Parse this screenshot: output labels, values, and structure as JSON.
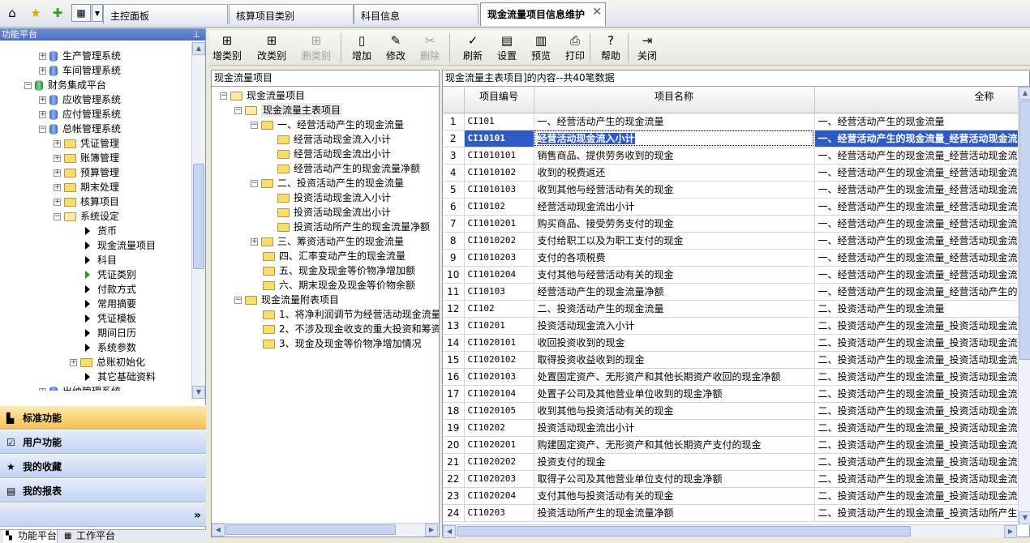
{
  "top_tabs": [
    {
      "label": "主控面板",
      "active": false
    },
    {
      "label": "核算项目类别",
      "active": false
    },
    {
      "label": "科目信息",
      "active": false
    },
    {
      "label": "现金流量项目信息维护",
      "active": true
    }
  ],
  "left_panel": {
    "title": "功能平台",
    "tree": [
      {
        "label": "生产管理系统",
        "level": 0,
        "icon": "db",
        "expander": "+"
      },
      {
        "label": "车间管理系统",
        "level": 0,
        "icon": "db",
        "expander": "+"
      },
      {
        "label": "财务集成平台",
        "level": -1,
        "icon": "db-green",
        "expander": "-"
      },
      {
        "label": "应收管理系统",
        "level": 0,
        "icon": "db",
        "expander": "+"
      },
      {
        "label": "应付管理系统",
        "level": 0,
        "icon": "db",
        "expander": "+"
      },
      {
        "label": "总帐管理系统",
        "level": 0,
        "icon": "db",
        "expander": "-"
      },
      {
        "label": "凭证管理",
        "level": 1,
        "icon": "folder",
        "expander": "+"
      },
      {
        "label": "账簿管理",
        "level": 1,
        "icon": "folder",
        "expander": "+"
      },
      {
        "label": "预算管理",
        "level": 1,
        "icon": "folder",
        "expander": "+"
      },
      {
        "label": "期末处理",
        "level": 1,
        "icon": "folder",
        "expander": "+"
      },
      {
        "label": "核算项目",
        "level": 1,
        "icon": "folder",
        "expander": "+"
      },
      {
        "label": "系统设定",
        "level": 1,
        "icon": "folder-open",
        "expander": "-"
      },
      {
        "label": "货币",
        "level": 2,
        "icon": "arrow",
        "expander": ""
      },
      {
        "label": "现金流量项目",
        "level": 2,
        "icon": "arrow",
        "expander": ""
      },
      {
        "label": "科目",
        "level": 2,
        "icon": "arrow",
        "expander": ""
      },
      {
        "label": "凭证类别",
        "level": 2,
        "icon": "arrow-green",
        "expander": ""
      },
      {
        "label": "付款方式",
        "level": 2,
        "icon": "arrow",
        "expander": ""
      },
      {
        "label": "常用摘要",
        "level": 2,
        "icon": "arrow",
        "expander": ""
      },
      {
        "label": "凭证模板",
        "level": 2,
        "icon": "arrow",
        "expander": ""
      },
      {
        "label": "期间日历",
        "level": 2,
        "icon": "arrow",
        "expander": ""
      },
      {
        "label": "系统参数",
        "level": 2,
        "icon": "arrow",
        "expander": ""
      },
      {
        "label": "总账初始化",
        "level": 2,
        "icon": "folder",
        "expander": "+"
      },
      {
        "label": "其它基础资料",
        "level": 2,
        "icon": "arrow",
        "expander": ""
      },
      {
        "label": "出纳管理系统",
        "level": 0,
        "icon": "db",
        "expander": "+"
      }
    ],
    "sections": [
      {
        "label": "标准功能",
        "selected": true,
        "icon": "standard-icon"
      },
      {
        "label": "用户功能",
        "selected": false,
        "icon": "user-icon"
      },
      {
        "label": "我的收藏",
        "selected": false,
        "icon": "star-icon"
      },
      {
        "label": "我的报表",
        "selected": false,
        "icon": "report-icon"
      }
    ],
    "more_glyph": "»",
    "bottom_tabs": [
      {
        "label": "功能平台",
        "active": true
      },
      {
        "label": "工作平台",
        "active": false
      }
    ]
  },
  "toolbar": [
    {
      "label": "增类别",
      "icon": "add-category-icon",
      "glyph": "⊞",
      "disabled": false
    },
    {
      "label": "改类别",
      "icon": "edit-category-icon",
      "glyph": "⊞",
      "disabled": false
    },
    {
      "label": "删类别",
      "icon": "delete-category-icon",
      "glyph": "⊞",
      "disabled": true
    },
    {
      "label": "增加",
      "icon": "add-icon",
      "glyph": "▯",
      "disabled": false
    },
    {
      "label": "修改",
      "icon": "edit-icon",
      "glyph": "✎",
      "disabled": false
    },
    {
      "label": "删除",
      "icon": "delete-icon",
      "glyph": "✂",
      "disabled": true
    },
    {
      "label": "刷新",
      "icon": "refresh-icon",
      "glyph": "✓",
      "disabled": false
    },
    {
      "label": "设置",
      "icon": "settings-icon",
      "glyph": "▤",
      "disabled": false
    },
    {
      "label": "预览",
      "icon": "preview-icon",
      "glyph": "▥",
      "disabled": false
    },
    {
      "label": "打印",
      "icon": "print-icon",
      "glyph": "⎙",
      "disabled": false
    },
    {
      "label": "帮助",
      "icon": "help-icon",
      "glyph": "?",
      "disabled": false
    },
    {
      "label": "关闭",
      "icon": "close-icon",
      "glyph": "⇥",
      "disabled": false
    }
  ],
  "category_panel": {
    "title": "现金流量项目",
    "tree": [
      {
        "label": "现金流量项目",
        "level": 0,
        "expander": "-",
        "open": true
      },
      {
        "label": "现金流量主表项目",
        "level": 1,
        "expander": "-",
        "open": true,
        "selected": true
      },
      {
        "label": "一、经营活动产生的现金流量",
        "level": 2,
        "expander": "-"
      },
      {
        "label": "经营活动现金流入小计",
        "level": 3,
        "expander": ""
      },
      {
        "label": "经营活动现金流出小计",
        "level": 3,
        "expander": ""
      },
      {
        "label": "经营活动产生的现金流量净额",
        "level": 3,
        "expander": ""
      },
      {
        "label": "二、投资活动产生的现金流量",
        "level": 2,
        "expander": "-"
      },
      {
        "label": "投资活动现金流入小计",
        "level": 3,
        "expander": ""
      },
      {
        "label": "投资活动现金流出小计",
        "level": 3,
        "expander": ""
      },
      {
        "label": "投资活动所产生的现金流量净额",
        "level": 3,
        "expander": ""
      },
      {
        "label": "三、筹资活动产生的现金流量",
        "level": 2,
        "expander": "+"
      },
      {
        "label": "四、汇率变动产生的现金流量",
        "level": 2,
        "expander": ""
      },
      {
        "label": "五、现金及现金等价物净增加额",
        "level": 2,
        "expander": ""
      },
      {
        "label": "六、期末现金及现金等价物余额",
        "level": 2,
        "expander": ""
      },
      {
        "label": "现金流量附表项目",
        "level": 1,
        "expander": "-"
      },
      {
        "label": "1、将净利润调节为经营活动现金流量",
        "level": 2,
        "expander": ""
      },
      {
        "label": "2、不涉及现金收支的重大投资和筹资",
        "level": 2,
        "expander": ""
      },
      {
        "label": "3、现金及现金等价物净增加情况",
        "level": 2,
        "expander": ""
      }
    ]
  },
  "grid_panel": {
    "title": "现金流量主表项目]的内容--共40笔数据",
    "columns": [
      "",
      "项目编号",
      "项目名称",
      "全称"
    ],
    "selected_row": 2,
    "rows": [
      {
        "n": "1",
        "code": "CI101",
        "name": "一、经营活动产生的现金流量",
        "full": "一、经营活动产生的现金流量"
      },
      {
        "n": "2",
        "code": "CI10101",
        "name": "经营活动现金流入小计",
        "full": "一、经营活动产生的现金流量_经营活动现金流入小计"
      },
      {
        "n": "3",
        "code": "CI1010101",
        "name": "销售商品、提供劳务收到的现金",
        "full": "一、经营活动产生的现金流量_经营活动现金流入小计_销售商品、提供劳务收到的现金"
      },
      {
        "n": "4",
        "code": "CI1010102",
        "name": "收到的税费返还",
        "full": "一、经营活动产生的现金流量_经营活动现金流入小计_收到的税费返还"
      },
      {
        "n": "5",
        "code": "CI1010103",
        "name": "收到其他与经营活动有关的现金",
        "full": "一、经营活动产生的现金流量_经营活动现金流入小计_收到其他与经营活动有关的现金"
      },
      {
        "n": "6",
        "code": "CI10102",
        "name": "经营活动现金流出小计",
        "full": "一、经营活动产生的现金流量_经营活动现金流出小计"
      },
      {
        "n": "7",
        "code": "CI1010201",
        "name": "购买商品、接受劳务支付的现金",
        "full": "一、经营活动产生的现金流量_经营活动现金流出小计_购买商品、接受劳务支付的现金"
      },
      {
        "n": "8",
        "code": "CI1010202",
        "name": "支付给职工以及为职工支付的现金",
        "full": "一、经营活动产生的现金流量_经营活动现金流出小计_支付给职工以及为职工支付的现金"
      },
      {
        "n": "9",
        "code": "CI1010203",
        "name": "支付的各项税费",
        "full": "一、经营活动产生的现金流量_经营活动现金流出小计_支付的各项税费"
      },
      {
        "n": "10",
        "code": "CI1010204",
        "name": "支付其他与经营活动有关的现金",
        "full": "一、经营活动产生的现金流量_经营活动现金流出小计_支付其他与经营活动有关的现金"
      },
      {
        "n": "11",
        "code": "CI10103",
        "name": "经营活动产生的现金流量净额",
        "full": "一、经营活动产生的现金流量_经营活动产生的现金流量净额"
      },
      {
        "n": "12",
        "code": "CI102",
        "name": "二、投资活动产生的现金流量",
        "full": "二、投资活动产生的现金流量"
      },
      {
        "n": "13",
        "code": "CI10201",
        "name": "投资活动现金流入小计",
        "full": "二、投资活动产生的现金流量_投资活动现金流入小计"
      },
      {
        "n": "14",
        "code": "CI1020101",
        "name": "收回投资收到的现金",
        "full": "二、投资活动产生的现金流量_投资活动现金流入小计_收回投资收到的现金"
      },
      {
        "n": "15",
        "code": "CI1020102",
        "name": "取得投资收益收到的现金",
        "full": "二、投资活动产生的现金流量_投资活动现金流入小计_取得投资收益收到的现金"
      },
      {
        "n": "16",
        "code": "CI1020103",
        "name": "处置固定资产、无形资产和其他长期资产收回的现金净额",
        "full": "二、投资活动产生的现金流量_投资活动现金流入小计_处置固定资产、无形资产和其他长期资产收回的现金净额"
      },
      {
        "n": "17",
        "code": "CI1020104",
        "name": "处置子公司及其他营业单位收到的现金净额",
        "full": "二、投资活动产生的现金流量_投资活动现金流入小计_处置子公司及其他营业单位收到的现金净额"
      },
      {
        "n": "18",
        "code": "CI1020105",
        "name": "收到其他与投资活动有关的现金",
        "full": "二、投资活动产生的现金流量_投资活动现金流入小计_收到其他与投资活动有关的现金"
      },
      {
        "n": "19",
        "code": "CI10202",
        "name": "投资活动现金流出小计",
        "full": "二、投资活动产生的现金流量_投资活动现金流出小计"
      },
      {
        "n": "20",
        "code": "CI1020201",
        "name": "购建固定资产、无形资产和其他长期资产支付的现金",
        "full": "二、投资活动产生的现金流量_投资活动现金流出小计_购建固定资产、无形资产和其他长期资产支付的现金"
      },
      {
        "n": "21",
        "code": "CI1020202",
        "name": "投资支付的现金",
        "full": "二、投资活动产生的现金流量_投资活动现金流出小计_投资支付的现金"
      },
      {
        "n": "22",
        "code": "CI1020203",
        "name": "取得子公司及其他营业单位支付的现金净额",
        "full": "二、投资活动产生的现金流量_投资活动现金流出小计_取得子公司及其他营业单位支付的现金净额"
      },
      {
        "n": "23",
        "code": "CI1020204",
        "name": "支付其他与投资活动有关的现金",
        "full": "二、投资活动产生的现金流量_投资活动现金流出小计_支付其他与投资活动有关的现金"
      },
      {
        "n": "24",
        "code": "CI10203",
        "name": "投资活动所产生的现金流量净额",
        "full": "二、投资活动产生的现金流量_投资活动所产生的现金流量净额"
      }
    ]
  }
}
